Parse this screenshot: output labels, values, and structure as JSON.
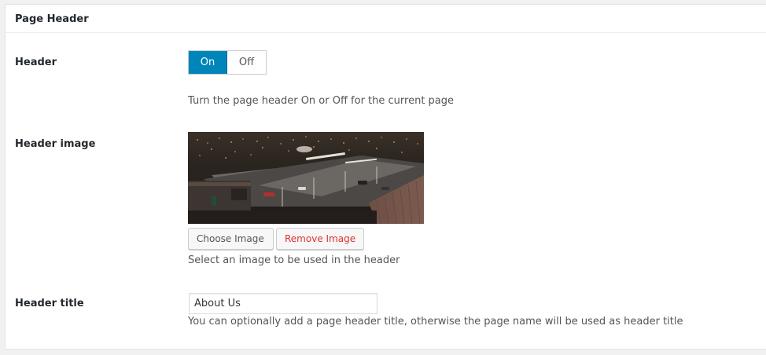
{
  "panel": {
    "title": "Page Header"
  },
  "header_field": {
    "label": "Header",
    "toggle_on": "On",
    "toggle_off": "Off",
    "selected": "On",
    "help": "Turn the page header On or Off for the current page"
  },
  "image_field": {
    "label": "Header image",
    "choose_label": "Choose Image",
    "remove_label": "Remove Image",
    "help": "Select an image to be used in the header"
  },
  "title_field": {
    "label": "Header title",
    "value": "About Us",
    "help": "You can optionally add a page header title, otherwise the page name will be used as header title"
  },
  "colors": {
    "accent": "#0085ba",
    "danger": "#dc3232"
  }
}
